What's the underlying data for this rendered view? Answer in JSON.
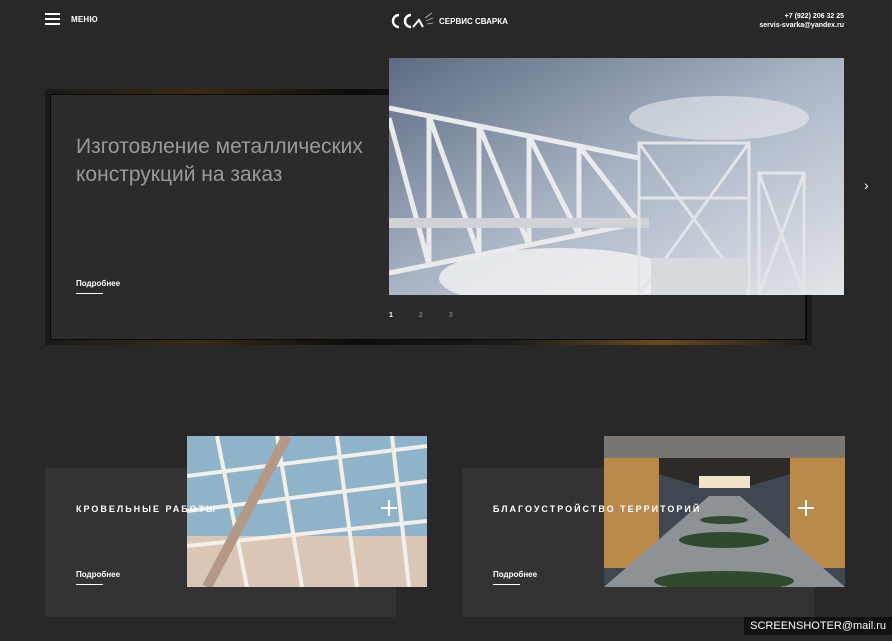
{
  "header": {
    "menu_label": "МЕНЮ",
    "logo_text": "СЕРВИС СВАРКА",
    "phone": "+7 (922) 206 32 25",
    "email": "servis-svarka@yandex.ru"
  },
  "hero": {
    "title": "Изготовление металлических конструкций на заказ",
    "more_label": "Подробнее",
    "slides": [
      "1",
      "2",
      "3"
    ],
    "next_icon": "›"
  },
  "services": [
    {
      "title": "КРОВЕЛЬНЫЕ РАБОТЫ",
      "more_label": "Подробнее"
    },
    {
      "title": "БЛАГОУСТРОЙСТВО ТЕРРИТОРИЙ",
      "more_label": "Подробнее"
    }
  ],
  "watermark": "SCREENSHOTER@mail.ru"
}
